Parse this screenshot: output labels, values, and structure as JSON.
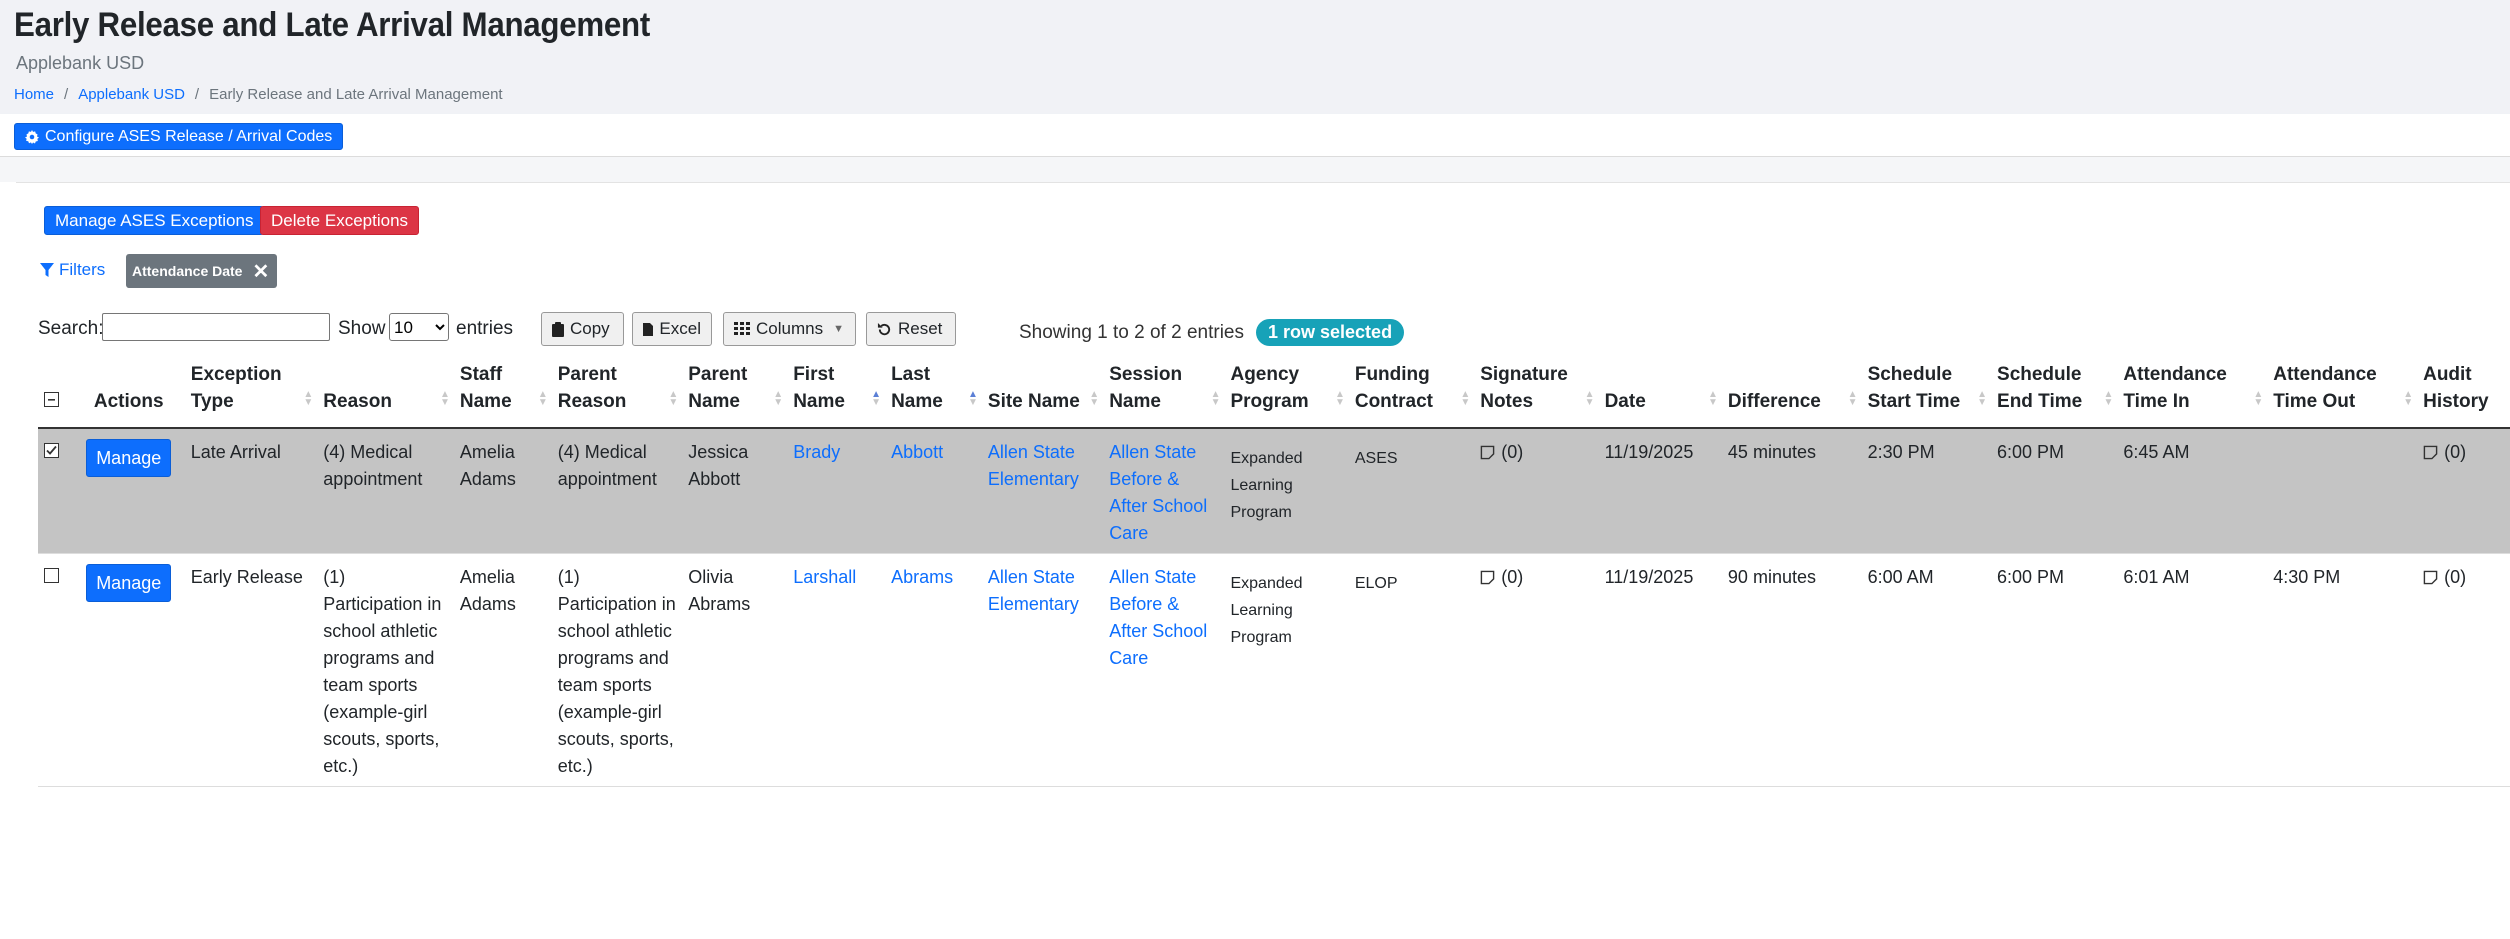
{
  "header": {
    "title": "Early Release and Late Arrival Management",
    "subtitle": "Applebank USD",
    "breadcrumb": [
      "Home",
      "Applebank USD",
      "Early Release and Late Arrival Management"
    ]
  },
  "toolbar": {
    "config_button": "Configure ASES Release / Arrival Codes"
  },
  "actions": {
    "manage_exceptions": "Manage ASES Exceptions",
    "delete_exceptions": "Delete Exceptions"
  },
  "filters": {
    "label": "Filters",
    "active_chip": "Attendance Date"
  },
  "datatable": {
    "search_label": "Search:",
    "search_value": "",
    "show_label": "Show",
    "page_size": "10",
    "entries_label": "entries",
    "buttons": [
      "Copy",
      "Excel",
      "Columns",
      "Reset"
    ],
    "info": "Showing 1 to 2 of 2 entries",
    "selected_badge": "1 row selected"
  },
  "table": {
    "columns": [
      "Actions",
      "Exception Type",
      "Reason",
      "Staff Name",
      "Parent Reason",
      "Parent Name",
      "First Name",
      "Last Name",
      "Site Name",
      "Session Name",
      "Agency Program",
      "Funding Contract",
      "Signature Notes",
      "Date",
      "Difference",
      "Schedule Start Time",
      "Schedule End Time",
      "Attendance Time In",
      "Attendance Time Out",
      "Audit History"
    ],
    "manage_label": "Manage",
    "rows": [
      {
        "selected": true,
        "exception_type": "Late Arrival",
        "reason": "(4) Medical appointment",
        "staff_name": "Amelia Adams",
        "parent_reason": "(4) Medical appointment",
        "parent_name": "Jessica Abbott",
        "first_name": "Brady",
        "last_name": "Abbott",
        "site_name": "Allen State Elementary",
        "session_name": "Allen State Before & After School Care",
        "agency_program": "Expanded Learning Program",
        "funding_contract": "ASES",
        "signature_notes": "(0)",
        "date": "11/19/2025",
        "difference": "45 minutes",
        "schedule_start": "2:30 PM",
        "schedule_end": "6:00 PM",
        "time_in": "6:45 AM",
        "time_out": "",
        "audit_history": "(0)"
      },
      {
        "selected": false,
        "exception_type": "Early Release",
        "reason": "(1) Participation in school athletic programs and team sports (example-girl scouts, sports, etc.)",
        "staff_name": "Amelia Adams",
        "parent_reason": "(1) Participation in school athletic programs and team sports (example-girl scouts, sports, etc.)",
        "parent_name": "Olivia Abrams",
        "first_name": "Larshall",
        "last_name": "Abrams",
        "site_name": "Allen State Elementary",
        "session_name": "Allen State Before & After School Care",
        "agency_program": "Expanded Learning Program",
        "funding_contract": "ELOP",
        "signature_notes": "(0)",
        "date": "11/19/2025",
        "difference": "90 minutes",
        "schedule_start": "6:00 AM",
        "schedule_end": "6:00 PM",
        "time_in": "6:01 AM",
        "time_out": "4:30 PM",
        "audit_history": "(0)"
      }
    ]
  },
  "colors": {
    "primary": "#0d6efd",
    "danger": "#dc3545",
    "info_badge": "#17a2b8",
    "selected_row": "#c4c4c4"
  }
}
